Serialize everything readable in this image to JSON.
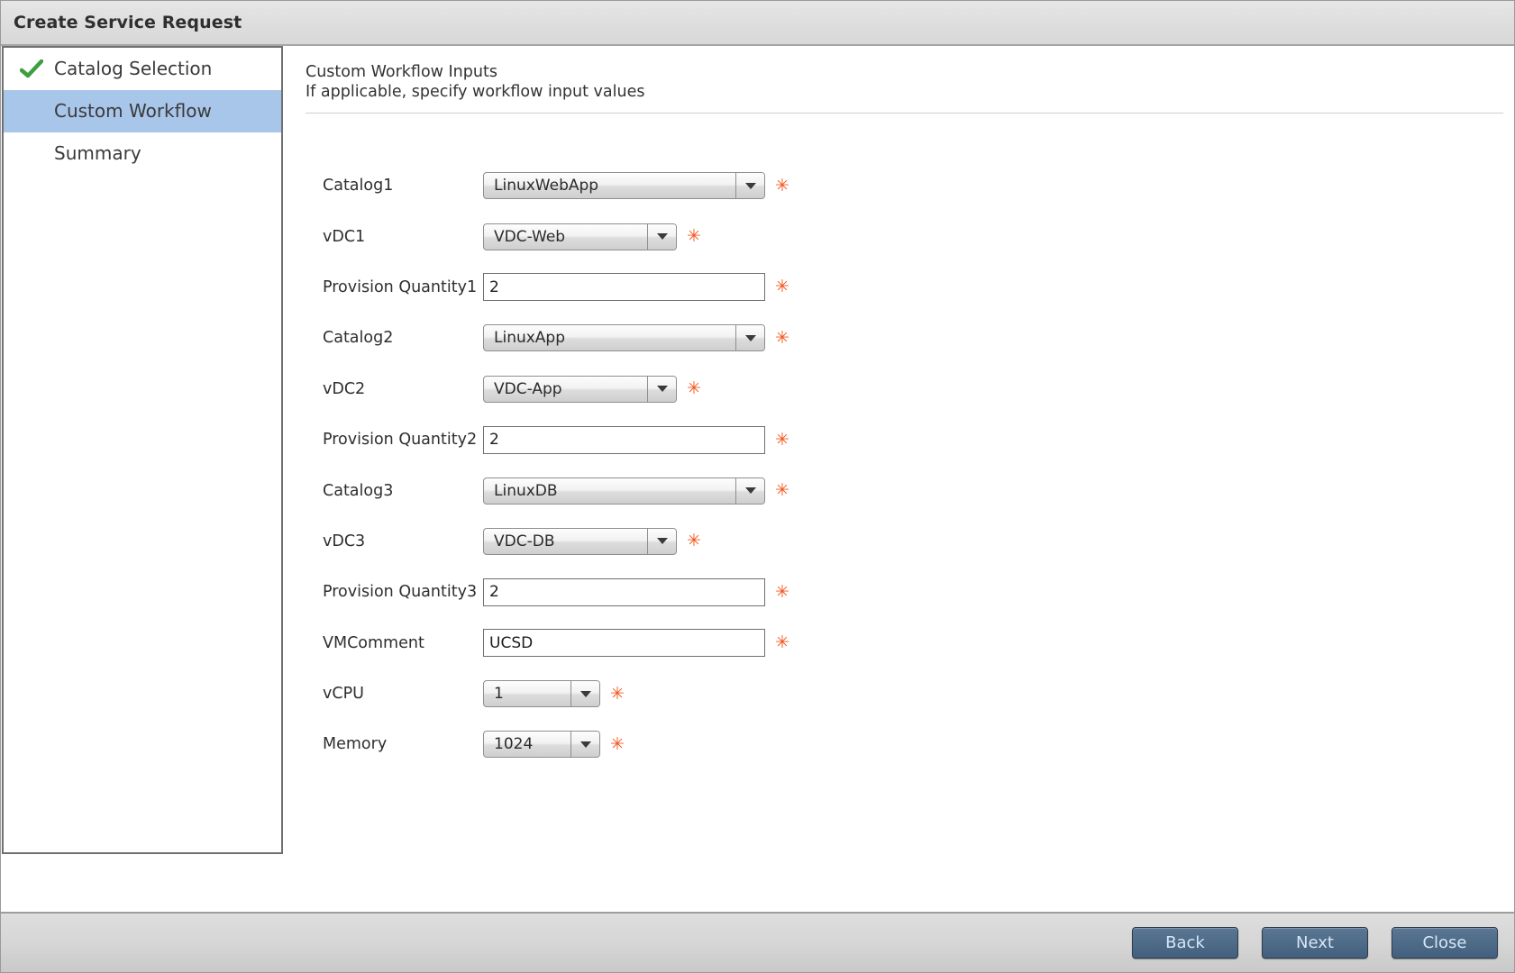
{
  "window": {
    "title": "Create Service Request"
  },
  "sidebar": {
    "items": [
      {
        "label": "Catalog Selection",
        "state": "completed",
        "icon": "check-icon"
      },
      {
        "label": "Custom Workflow",
        "state": "selected",
        "icon": ""
      },
      {
        "label": "Summary",
        "state": "default",
        "icon": ""
      }
    ]
  },
  "content": {
    "heading": "Custom Workflow Inputs",
    "subheading": "If applicable, specify workflow input values"
  },
  "form": {
    "required_marker": "✳",
    "rows": [
      {
        "label": "Catalog1",
        "type": "combo",
        "value": "LinuxWebApp",
        "width": "wide",
        "required": true
      },
      {
        "label": "vDC1",
        "type": "combo",
        "value": "VDC-Web",
        "width": "mid",
        "required": true
      },
      {
        "label": "Provision Quantity1",
        "type": "textbox",
        "value": "2",
        "width": "wide",
        "required": true
      },
      {
        "label": "Catalog2",
        "type": "combo",
        "value": "LinuxApp",
        "width": "wide",
        "required": true
      },
      {
        "label": "vDC2",
        "type": "combo",
        "value": "VDC-App",
        "width": "mid",
        "required": true
      },
      {
        "label": "Provision Quantity2",
        "type": "textbox",
        "value": "2",
        "width": "wide",
        "required": true
      },
      {
        "label": "Catalog3",
        "type": "combo",
        "value": "LinuxDB",
        "width": "wide",
        "required": true
      },
      {
        "label": "vDC3",
        "type": "combo",
        "value": "VDC-DB",
        "width": "mid",
        "required": true
      },
      {
        "label": "Provision Quantity3",
        "type": "textbox",
        "value": "2",
        "width": "wide",
        "required": true
      },
      {
        "label": "VMComment",
        "type": "textbox",
        "value": "UCSD",
        "width": "wide",
        "required": true
      },
      {
        "label": "vCPU",
        "type": "combo",
        "value": "1",
        "width": "narrow",
        "required": true
      },
      {
        "label": "Memory",
        "type": "combo",
        "value": "1024",
        "width": "narrow",
        "required": true
      }
    ]
  },
  "footer": {
    "buttons": [
      {
        "label": "Back"
      },
      {
        "label": "Next"
      },
      {
        "label": "Close"
      }
    ]
  },
  "colors": {
    "selected_row": "#a8c6e9",
    "required_orange": "#f2551b",
    "button_blue": "#4e6b88",
    "check_green": "#3f9e3f"
  }
}
